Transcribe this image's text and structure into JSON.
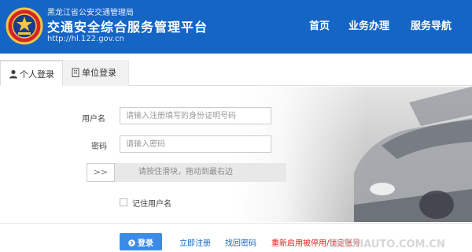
{
  "header": {
    "bureau": "黑龙江省公安交通管理局",
    "title": "交通安全综合服务管理平台",
    "url": "http://hl.122.gov.cn",
    "nav": [
      "首页",
      "业务办理",
      "服务导航"
    ],
    "bg_color": "#1565c5"
  },
  "tabs": [
    {
      "label": "个人登录",
      "icon": "user-icon",
      "active": true
    },
    {
      "label": "单位登录",
      "icon": "building-icon",
      "active": false
    }
  ],
  "form": {
    "username_label": "用户名",
    "username_placeholder": "请输入注册填写的身份证明号码",
    "password_label": "密码",
    "password_placeholder": "请输入密码",
    "slider_handle": ">>",
    "slider_text": "请按住滑块，拖动到最右边",
    "remember_label": "记住用户名"
  },
  "actions": {
    "login": "登录",
    "register": "立即注册",
    "retrieve": "找回密码",
    "reactivate": "重新启用被停用/锁定账号",
    "accent": "#3c8be6",
    "alert_color": "#e02020"
  },
  "watermark": "CHEXIAUTO.COM.CN"
}
